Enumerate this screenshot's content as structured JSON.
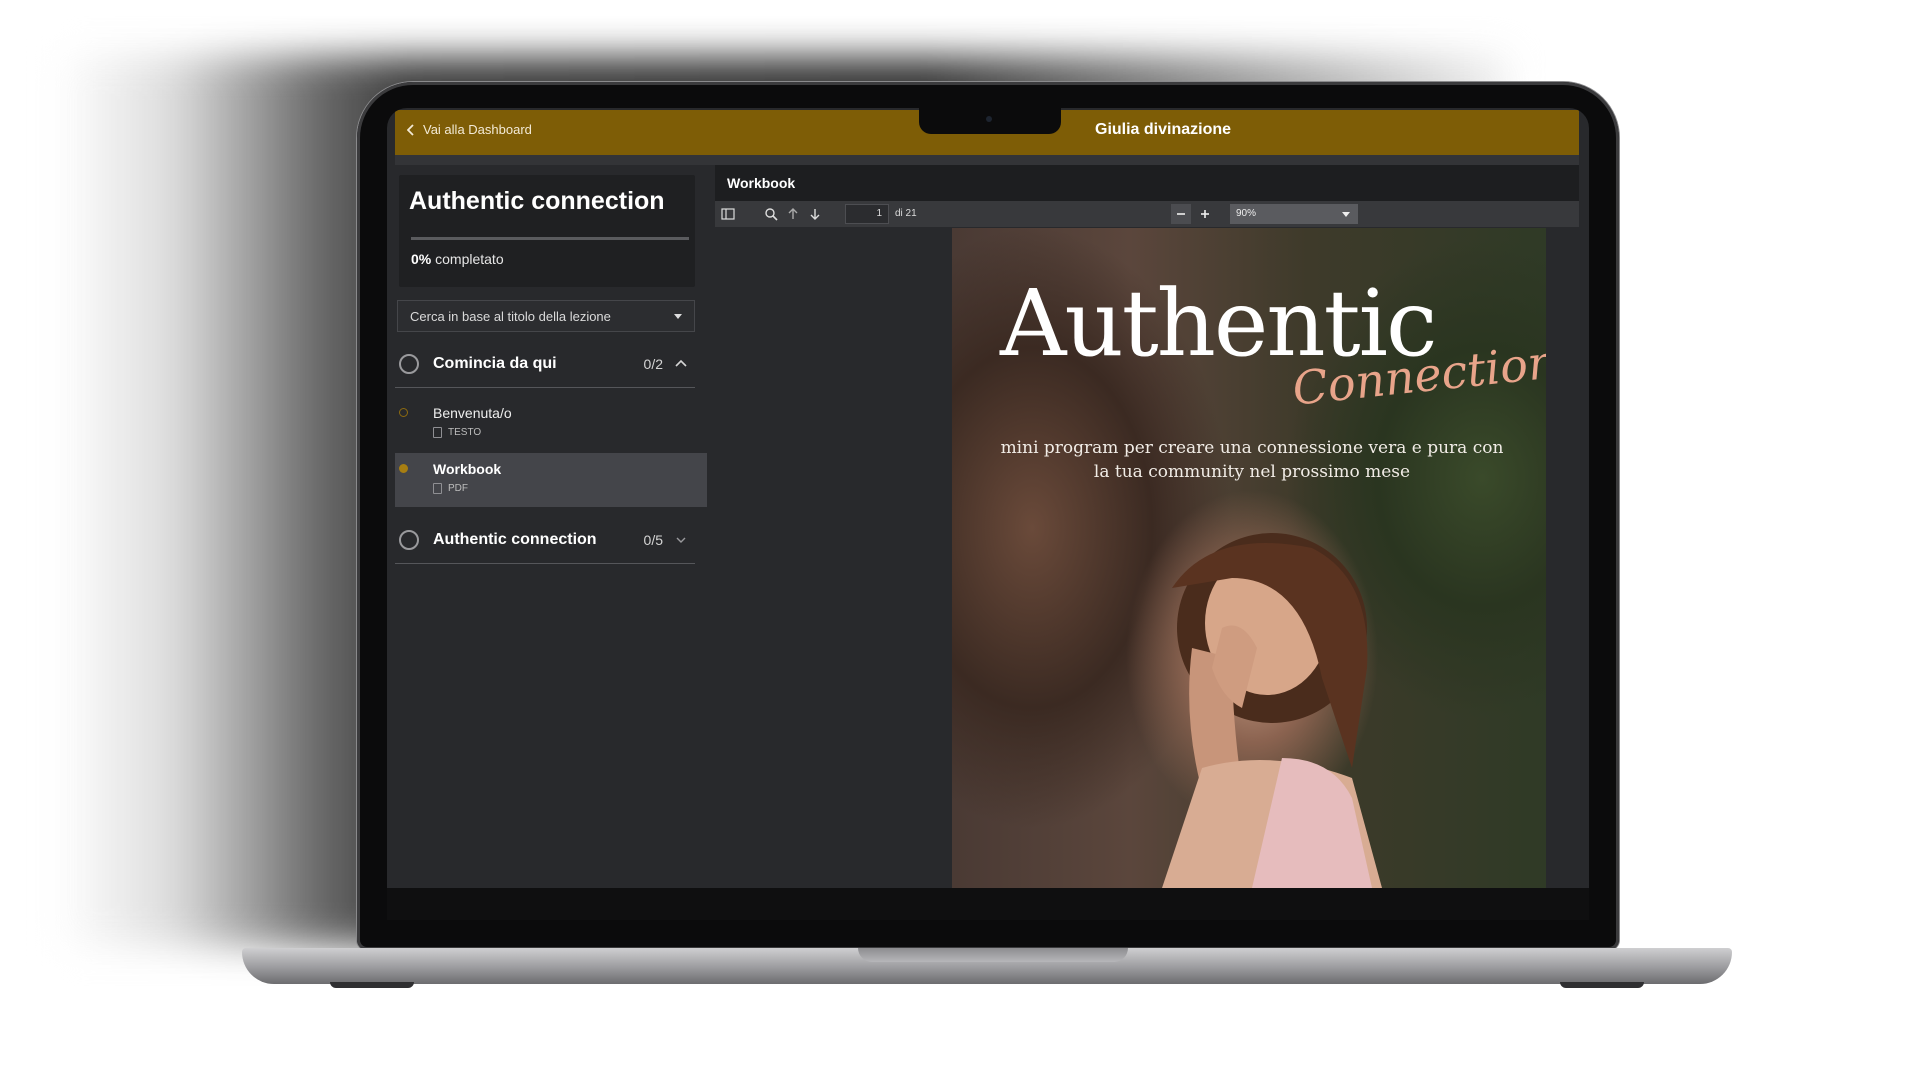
{
  "topbar": {
    "back_label": "Vai alla Dashboard",
    "course_name": "Giulia divinazione",
    "color": "#7e5d06"
  },
  "course_card": {
    "title": "Authentic connection",
    "progress_percent": 0,
    "progress_value_label": "0%",
    "progress_suffix": "completato"
  },
  "search": {
    "placeholder": "Cerca in base al titolo della lezione"
  },
  "sections": [
    {
      "title": "Comincia da qui",
      "count": "0/2",
      "expanded": true,
      "lessons": [
        {
          "title": "Benvenuta/o",
          "type": "TESTO",
          "active": false
        },
        {
          "title": "Workbook",
          "type": "PDF",
          "active": true
        }
      ]
    },
    {
      "title": "Authentic connection",
      "count": "0/5",
      "expanded": false,
      "lessons": []
    }
  ],
  "viewer": {
    "title": "Workbook",
    "page_current": "1",
    "page_total_label": "di 21",
    "zoom": "90%",
    "icons": [
      "sidebar-toggle-icon",
      "search-icon",
      "arrow-up-icon",
      "arrow-down-icon",
      "minus-icon",
      "plus-icon"
    ]
  },
  "pdf": {
    "title": "Authentic",
    "script_title": "Connection",
    "subtitle": "mini program per creare una connessione vera e pura con la tua community nel prossimo mese"
  }
}
